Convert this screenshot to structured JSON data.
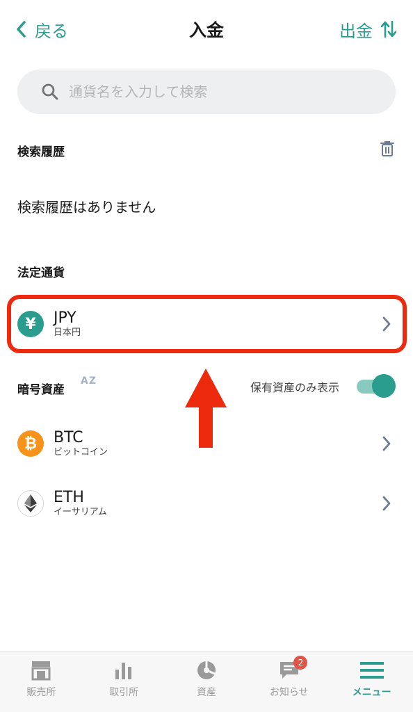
{
  "header": {
    "back_label": "戻る",
    "title": "入金",
    "withdraw_label": "出金"
  },
  "search": {
    "placeholder": "通貨名を入力して検索"
  },
  "history": {
    "label": "検索履歴",
    "empty_text": "検索履歴はありません"
  },
  "fiat": {
    "label": "法定通貨",
    "items": [
      {
        "code": "JPY",
        "name": "日本円",
        "symbol": "¥",
        "color": "#2a9d8f"
      }
    ]
  },
  "crypto": {
    "label": "暗号資産",
    "sort_icon_text": "AZ",
    "holdings_toggle_label": "保有資産のみ表示",
    "holdings_toggle_on": true,
    "items": [
      {
        "code": "BTC",
        "name": "ビットコイン",
        "symbol": "₿",
        "color": "#f7931a"
      },
      {
        "code": "ETH",
        "name": "イーサリアム",
        "symbol": "Ξ",
        "color": "#3c3c3d"
      }
    ]
  },
  "tabbar": {
    "items": [
      {
        "label": "販売所",
        "icon": "store-icon"
      },
      {
        "label": "取引所",
        "icon": "bar-chart-icon"
      },
      {
        "label": "資産",
        "icon": "pie-chart-icon"
      },
      {
        "label": "お知らせ",
        "icon": "message-icon",
        "badge": "2"
      },
      {
        "label": "メニュー",
        "icon": "hamburger-menu-icon",
        "active": true
      }
    ]
  },
  "colors": {
    "accent": "#2a9d8f",
    "highlight": "#ee2a0e",
    "badge": "#e05548"
  }
}
